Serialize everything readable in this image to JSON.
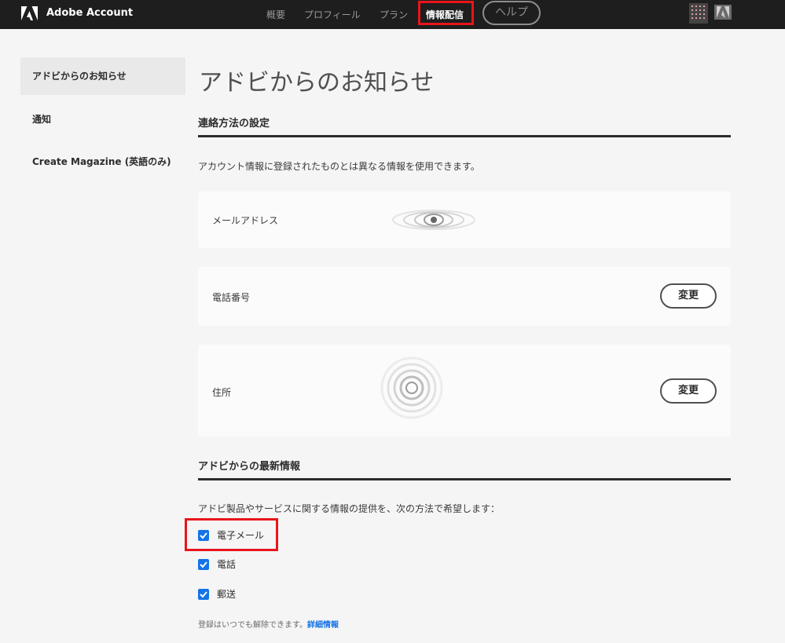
{
  "header": {
    "brand": "Adobe Account",
    "nav": [
      "概要",
      "プロフィール",
      "プラン",
      "情報配信"
    ],
    "help": "ヘルプ"
  },
  "sidebar": {
    "items": [
      {
        "label": "アドビからのお知らせ"
      },
      {
        "label": "通知"
      },
      {
        "label": "Create Magazine (英語のみ)"
      }
    ]
  },
  "main": {
    "title": "アドビからのお知らせ",
    "contact": {
      "heading": "連絡方法の設定",
      "description": "アカウント情報に登録されたものとは異なる情報を使用できます。",
      "rows": [
        {
          "label": "メールアドレス"
        },
        {
          "label": "電話番号",
          "button": "変更"
        },
        {
          "label": "住所",
          "button": "変更"
        }
      ]
    },
    "updates": {
      "heading": "アドビからの最新情報",
      "description": "アドビ製品やサービスに関する情報の提供を、次の方法で希望します：",
      "options": [
        {
          "label": "電子メール",
          "checked": true
        },
        {
          "label": "電話",
          "checked": true
        },
        {
          "label": "郵送",
          "checked": true
        }
      ],
      "footnote": "登録はいつでも解除できます。",
      "more_link": "詳細情報"
    }
  },
  "colors": {
    "accent": "#1473e6",
    "highlight": "#e8151b",
    "topbar": "#1e1e1e"
  }
}
